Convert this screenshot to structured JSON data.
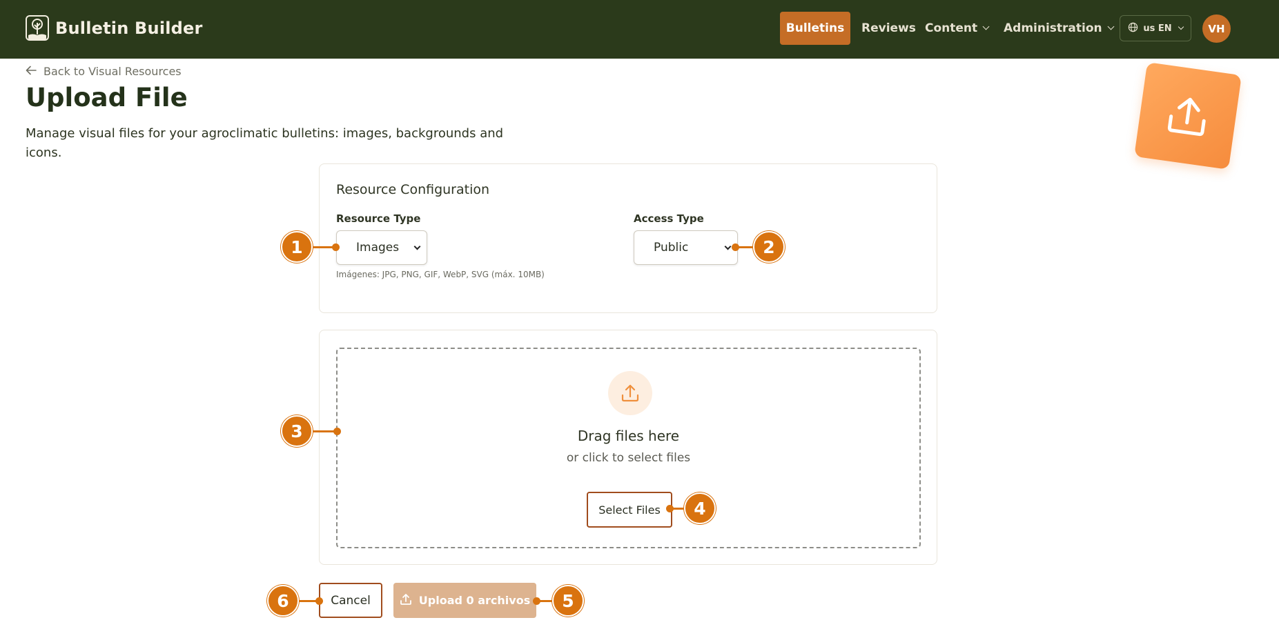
{
  "navbar": {
    "brand": "Bulletin Builder",
    "items": [
      {
        "label": "Bulletins",
        "active": true
      },
      {
        "label": "Reviews",
        "active": false
      },
      {
        "label": "Content",
        "dropdown": true
      },
      {
        "label": "Administration",
        "dropdown": true
      }
    ],
    "language": "us EN",
    "avatar_initials": "VH"
  },
  "header": {
    "back_link": "Back to Visual Resources",
    "title": "Upload File",
    "description": "Manage visual files for your agroclimatic bulletins: images, backgrounds and icons."
  },
  "config": {
    "title": "Resource Configuration",
    "resource_type_label": "Resource Type",
    "resource_type_value": "Images",
    "resource_type_hint": "Imágenes: JPG, PNG, GIF, WebP, SVG (máx. 10MB)",
    "access_type_label": "Access Type",
    "access_type_value": "Public"
  },
  "dropzone": {
    "title": "Drag files here",
    "subtitle": "or click to select files",
    "select_button": "Select Files"
  },
  "actions": {
    "cancel": "Cancel",
    "upload": "Upload 0 archivos"
  },
  "callouts": [
    "1",
    "2",
    "3",
    "4",
    "5",
    "6"
  ],
  "colors": {
    "navbar": "#2b3a1b",
    "accent": "#c56d26",
    "callout": "#d9730f",
    "upload_disabled": "#ddb38f"
  },
  "icons": {
    "brand": "tree-book-icon",
    "back": "arrow-left-icon",
    "language": "globe-icon",
    "hero": "upload-tray-icon",
    "dropzone": "upload-icon"
  }
}
